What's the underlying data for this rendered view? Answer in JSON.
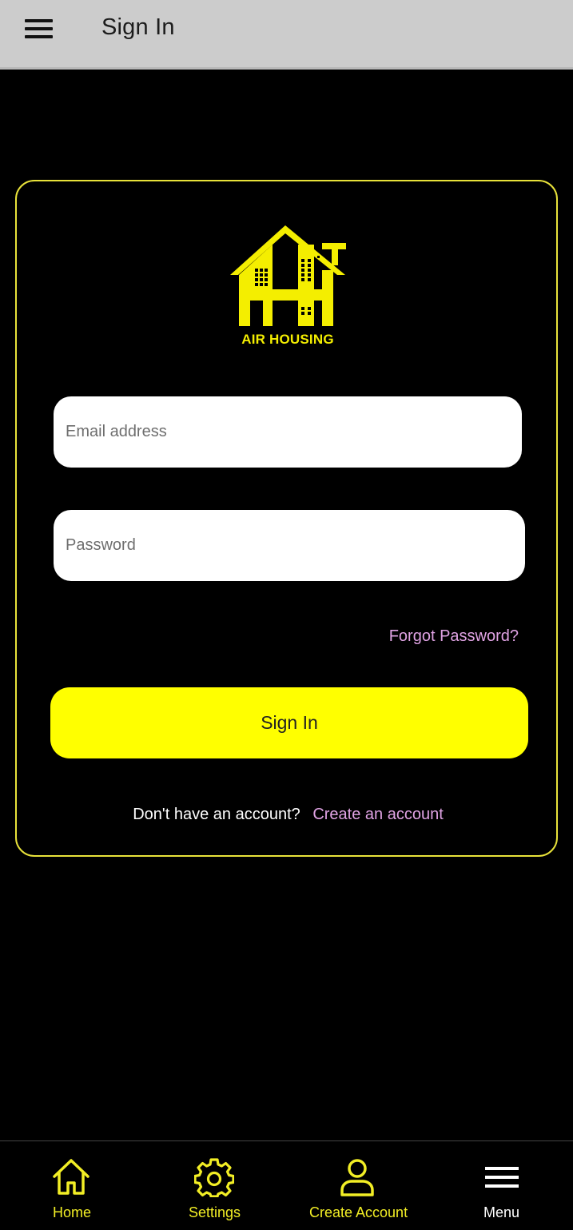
{
  "header": {
    "title": "Sign In",
    "menu_icon": "hamburger-icon"
  },
  "logo": {
    "brand_text": "AIR HOUSING",
    "icon": "house-logo-icon",
    "color": "#f4ee00"
  },
  "form": {
    "email_placeholder": "Email address",
    "email_value": "",
    "password_placeholder": "Password",
    "password_value": "",
    "forgot_label": "Forgot Password?",
    "submit_label": "Sign In",
    "signup_question": "Don't have an account?",
    "signup_link": "Create an account"
  },
  "bottom_nav": {
    "items": [
      {
        "label": "Home",
        "icon": "home-icon"
      },
      {
        "label": "Settings",
        "icon": "gear-icon"
      },
      {
        "label": "Create Account",
        "icon": "user-icon"
      },
      {
        "label": "Menu",
        "icon": "menu-icon"
      }
    ]
  },
  "colors": {
    "accent": "#ffff00",
    "card_border": "#e8e23a",
    "link": "#e0a3e4",
    "background": "#000000",
    "topbar": "#cccccc"
  }
}
